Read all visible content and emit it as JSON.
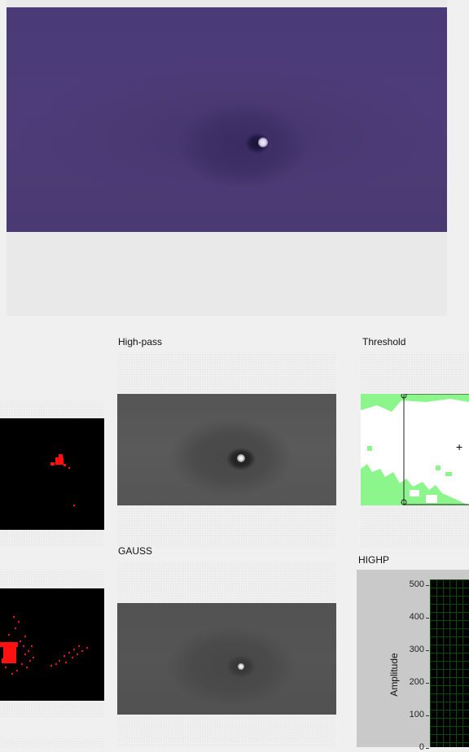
{
  "labels": {
    "high_pass": "High-pass",
    "threshold": "Threshold",
    "gauss": "GAUSS",
    "highp": "HIGHP"
  },
  "threshold_marker": "+",
  "chart_data": {
    "type": "line",
    "title": "HIGHP",
    "ylabel": "Amplitude",
    "y_ticks": [
      "500",
      "400",
      "300",
      "200",
      "100",
      "0"
    ],
    "ylim": [
      0,
      500
    ],
    "grid": true,
    "series": []
  },
  "colors": {
    "main_frame": "#4c3b78",
    "threshold_fill": "#8cf58c",
    "blob_red": "#ff1010",
    "plot_background": "#000000",
    "plot_grid": "#0b4a0b"
  }
}
